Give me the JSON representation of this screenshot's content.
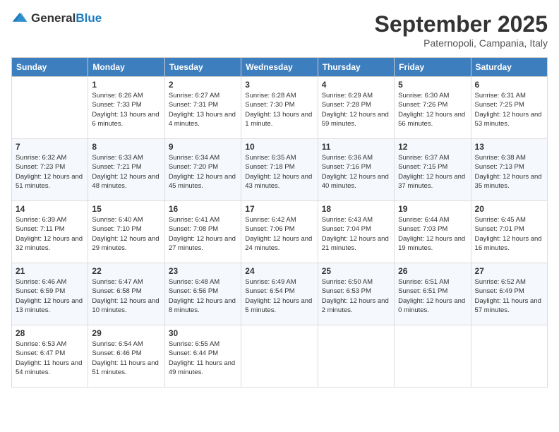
{
  "header": {
    "logo_general": "General",
    "logo_blue": "Blue",
    "month": "September 2025",
    "location": "Paternopoli, Campania, Italy"
  },
  "days_of_week": [
    "Sunday",
    "Monday",
    "Tuesday",
    "Wednesday",
    "Thursday",
    "Friday",
    "Saturday"
  ],
  "weeks": [
    [
      {
        "day": "",
        "sunrise": "",
        "sunset": "",
        "daylight": ""
      },
      {
        "day": "1",
        "sunrise": "Sunrise: 6:26 AM",
        "sunset": "Sunset: 7:33 PM",
        "daylight": "Daylight: 13 hours and 6 minutes."
      },
      {
        "day": "2",
        "sunrise": "Sunrise: 6:27 AM",
        "sunset": "Sunset: 7:31 PM",
        "daylight": "Daylight: 13 hours and 4 minutes."
      },
      {
        "day": "3",
        "sunrise": "Sunrise: 6:28 AM",
        "sunset": "Sunset: 7:30 PM",
        "daylight": "Daylight: 13 hours and 1 minute."
      },
      {
        "day": "4",
        "sunrise": "Sunrise: 6:29 AM",
        "sunset": "Sunset: 7:28 PM",
        "daylight": "Daylight: 12 hours and 59 minutes."
      },
      {
        "day": "5",
        "sunrise": "Sunrise: 6:30 AM",
        "sunset": "Sunset: 7:26 PM",
        "daylight": "Daylight: 12 hours and 56 minutes."
      },
      {
        "day": "6",
        "sunrise": "Sunrise: 6:31 AM",
        "sunset": "Sunset: 7:25 PM",
        "daylight": "Daylight: 12 hours and 53 minutes."
      }
    ],
    [
      {
        "day": "7",
        "sunrise": "Sunrise: 6:32 AM",
        "sunset": "Sunset: 7:23 PM",
        "daylight": "Daylight: 12 hours and 51 minutes."
      },
      {
        "day": "8",
        "sunrise": "Sunrise: 6:33 AM",
        "sunset": "Sunset: 7:21 PM",
        "daylight": "Daylight: 12 hours and 48 minutes."
      },
      {
        "day": "9",
        "sunrise": "Sunrise: 6:34 AM",
        "sunset": "Sunset: 7:20 PM",
        "daylight": "Daylight: 12 hours and 45 minutes."
      },
      {
        "day": "10",
        "sunrise": "Sunrise: 6:35 AM",
        "sunset": "Sunset: 7:18 PM",
        "daylight": "Daylight: 12 hours and 43 minutes."
      },
      {
        "day": "11",
        "sunrise": "Sunrise: 6:36 AM",
        "sunset": "Sunset: 7:16 PM",
        "daylight": "Daylight: 12 hours and 40 minutes."
      },
      {
        "day": "12",
        "sunrise": "Sunrise: 6:37 AM",
        "sunset": "Sunset: 7:15 PM",
        "daylight": "Daylight: 12 hours and 37 minutes."
      },
      {
        "day": "13",
        "sunrise": "Sunrise: 6:38 AM",
        "sunset": "Sunset: 7:13 PM",
        "daylight": "Daylight: 12 hours and 35 minutes."
      }
    ],
    [
      {
        "day": "14",
        "sunrise": "Sunrise: 6:39 AM",
        "sunset": "Sunset: 7:11 PM",
        "daylight": "Daylight: 12 hours and 32 minutes."
      },
      {
        "day": "15",
        "sunrise": "Sunrise: 6:40 AM",
        "sunset": "Sunset: 7:10 PM",
        "daylight": "Daylight: 12 hours and 29 minutes."
      },
      {
        "day": "16",
        "sunrise": "Sunrise: 6:41 AM",
        "sunset": "Sunset: 7:08 PM",
        "daylight": "Daylight: 12 hours and 27 minutes."
      },
      {
        "day": "17",
        "sunrise": "Sunrise: 6:42 AM",
        "sunset": "Sunset: 7:06 PM",
        "daylight": "Daylight: 12 hours and 24 minutes."
      },
      {
        "day": "18",
        "sunrise": "Sunrise: 6:43 AM",
        "sunset": "Sunset: 7:04 PM",
        "daylight": "Daylight: 12 hours and 21 minutes."
      },
      {
        "day": "19",
        "sunrise": "Sunrise: 6:44 AM",
        "sunset": "Sunset: 7:03 PM",
        "daylight": "Daylight: 12 hours and 19 minutes."
      },
      {
        "day": "20",
        "sunrise": "Sunrise: 6:45 AM",
        "sunset": "Sunset: 7:01 PM",
        "daylight": "Daylight: 12 hours and 16 minutes."
      }
    ],
    [
      {
        "day": "21",
        "sunrise": "Sunrise: 6:46 AM",
        "sunset": "Sunset: 6:59 PM",
        "daylight": "Daylight: 12 hours and 13 minutes."
      },
      {
        "day": "22",
        "sunrise": "Sunrise: 6:47 AM",
        "sunset": "Sunset: 6:58 PM",
        "daylight": "Daylight: 12 hours and 10 minutes."
      },
      {
        "day": "23",
        "sunrise": "Sunrise: 6:48 AM",
        "sunset": "Sunset: 6:56 PM",
        "daylight": "Daylight: 12 hours and 8 minutes."
      },
      {
        "day": "24",
        "sunrise": "Sunrise: 6:49 AM",
        "sunset": "Sunset: 6:54 PM",
        "daylight": "Daylight: 12 hours and 5 minutes."
      },
      {
        "day": "25",
        "sunrise": "Sunrise: 6:50 AM",
        "sunset": "Sunset: 6:53 PM",
        "daylight": "Daylight: 12 hours and 2 minutes."
      },
      {
        "day": "26",
        "sunrise": "Sunrise: 6:51 AM",
        "sunset": "Sunset: 6:51 PM",
        "daylight": "Daylight: 12 hours and 0 minutes."
      },
      {
        "day": "27",
        "sunrise": "Sunrise: 6:52 AM",
        "sunset": "Sunset: 6:49 PM",
        "daylight": "Daylight: 11 hours and 57 minutes."
      }
    ],
    [
      {
        "day": "28",
        "sunrise": "Sunrise: 6:53 AM",
        "sunset": "Sunset: 6:47 PM",
        "daylight": "Daylight: 11 hours and 54 minutes."
      },
      {
        "day": "29",
        "sunrise": "Sunrise: 6:54 AM",
        "sunset": "Sunset: 6:46 PM",
        "daylight": "Daylight: 11 hours and 51 minutes."
      },
      {
        "day": "30",
        "sunrise": "Sunrise: 6:55 AM",
        "sunset": "Sunset: 6:44 PM",
        "daylight": "Daylight: 11 hours and 49 minutes."
      },
      {
        "day": "",
        "sunrise": "",
        "sunset": "",
        "daylight": ""
      },
      {
        "day": "",
        "sunrise": "",
        "sunset": "",
        "daylight": ""
      },
      {
        "day": "",
        "sunrise": "",
        "sunset": "",
        "daylight": ""
      },
      {
        "day": "",
        "sunrise": "",
        "sunset": "",
        "daylight": ""
      }
    ]
  ]
}
